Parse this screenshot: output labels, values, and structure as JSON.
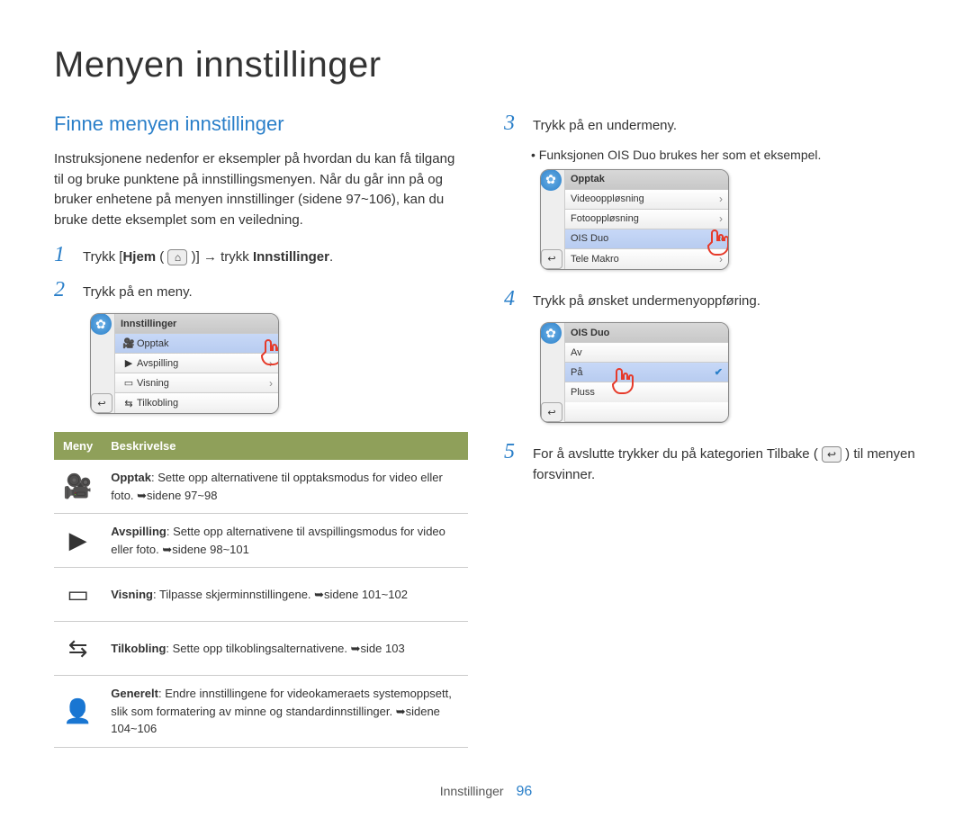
{
  "title": "Menyen innstillinger",
  "sectionTitle": "Finne menyen innstillinger",
  "intro": "Instruksjonene nedenfor er eksempler på hvordan du kan få tilgang til og bruke punktene på innstillingsmenyen. Når du går inn på og bruker enhetene på menyen innstillinger (sidene 97~106), kan du bruke dette eksemplet som en veiledning.",
  "steps": {
    "s1_pre": "Trykk [",
    "s1_bold1": "Hjem",
    "s1_mid": " ( ",
    "s1_post": " )] → trykk ",
    "s1_bold2": "Innstillinger",
    "s1_end": ".",
    "s2": "Trykk på en meny.",
    "s3": "Trykk på en undermeny.",
    "s3_note": "Funksjonen OIS Duo brukes her som et eksempel.",
    "s4": "Trykk på ønsket undermenyoppføring.",
    "s5_pre": "For å avslutte trykker du på kategorien Tilbake ( ",
    "s5_post": " ) til menyen forsvinner."
  },
  "phone1": {
    "header": "Innstillinger",
    "r1": "Opptak",
    "r2": "Avspilling",
    "r3": "Visning",
    "r4": "Tilkobling"
  },
  "phone2": {
    "header": "Opptak",
    "r1": "Videooppløsning",
    "r2": "Fotooppløsning",
    "r3": "OIS Duo",
    "r4": "Tele Makro"
  },
  "phone3": {
    "header": "OIS Duo",
    "r1": "Av",
    "r2": "På",
    "r3": "Pluss"
  },
  "desc": {
    "headMenu": "Meny",
    "headDesc": "Beskrivelse",
    "rows": [
      {
        "name": "Opptak",
        "text": ": Sette opp alternativene til opptaksmodus for video eller foto. ➥sidene 97~98",
        "icon": "camcorder"
      },
      {
        "name": "Avspilling",
        "text": ": Sette opp alternativene til avspillingsmodus for video eller foto. ➥sidene 98~101",
        "icon": "play"
      },
      {
        "name": "Visning",
        "text": ": Tilpasse skjerminnstillingene. ➥sidene 101~102",
        "icon": "display"
      },
      {
        "name": "Tilkobling",
        "text": ": Sette opp tilkoblingsalternativene. ➥side 103",
        "icon": "transfer"
      },
      {
        "name": "Generelt",
        "text": ": Endre innstillingene for videokameraets systemoppsett, slik som formatering av minne og standardinnstillinger. ➥sidene 104~106",
        "icon": "person"
      }
    ]
  },
  "footer": {
    "section": "Innstillinger",
    "page": "96"
  }
}
